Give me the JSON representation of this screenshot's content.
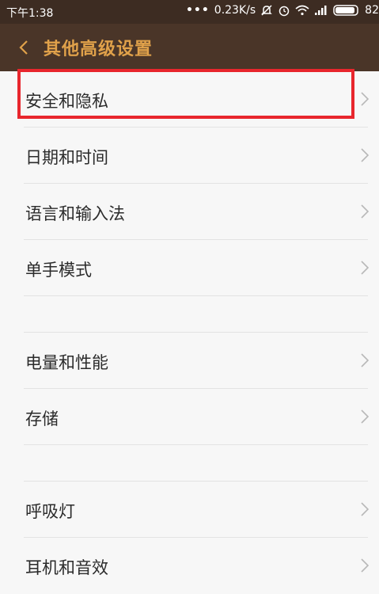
{
  "status_bar": {
    "time": "下午1:38",
    "network_speed": "0.23K/s",
    "battery_text": "82"
  },
  "header": {
    "title": "其他高级设置"
  },
  "menu": {
    "group1": [
      {
        "label": "安全和隐私"
      },
      {
        "label": "日期和时间"
      },
      {
        "label": "语言和输入法"
      },
      {
        "label": "单手模式"
      }
    ],
    "group2": [
      {
        "label": "电量和性能"
      },
      {
        "label": "存储"
      }
    ],
    "group3": [
      {
        "label": "呼吸灯"
      },
      {
        "label": "耳机和音效"
      }
    ]
  },
  "colors": {
    "header_bg": "#4a3528",
    "title": "#e0a14a",
    "highlight": "#e8262d"
  }
}
